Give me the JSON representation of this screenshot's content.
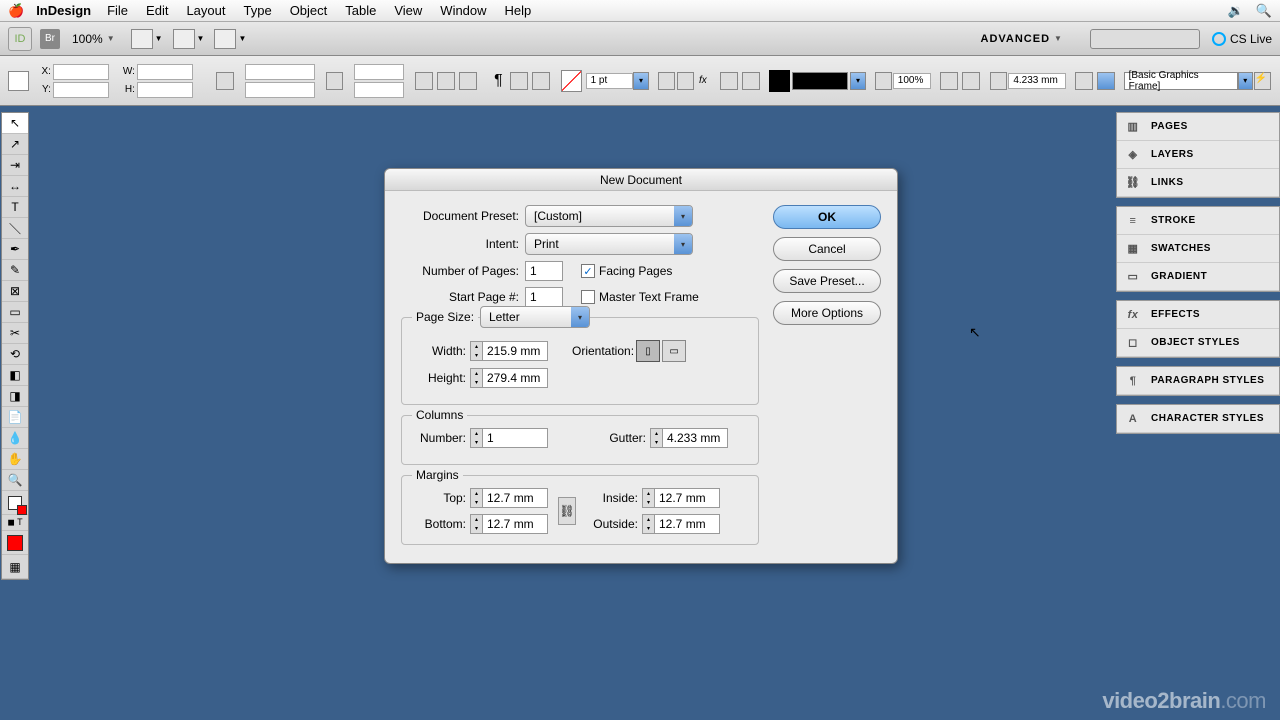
{
  "menubar": {
    "app": "InDesign",
    "items": [
      "File",
      "Edit",
      "Layout",
      "Type",
      "Object",
      "Table",
      "View",
      "Window",
      "Help"
    ]
  },
  "appbar": {
    "zoom": "100%",
    "workspace": "ADVANCED",
    "cs_live": "CS Live"
  },
  "controlbar": {
    "x_label": "X:",
    "y_label": "Y:",
    "w_label": "W:",
    "h_label": "H:",
    "stroke_weight": "1 pt",
    "opacity": "100%",
    "gutter_val": "4.233 mm",
    "preset": "[Basic Graphics Frame]"
  },
  "panels": {
    "group1": [
      "PAGES",
      "LAYERS",
      "LINKS"
    ],
    "group2": [
      "STROKE",
      "SWATCHES",
      "GRADIENT"
    ],
    "group3": [
      "EFFECTS",
      "OBJECT STYLES"
    ],
    "group4": [
      "PARAGRAPH STYLES"
    ],
    "group5": [
      "CHARACTER STYLES"
    ]
  },
  "dialog": {
    "title": "New Document",
    "doc_preset_label": "Document Preset:",
    "doc_preset_value": "[Custom]",
    "intent_label": "Intent:",
    "intent_value": "Print",
    "num_pages_label": "Number of Pages:",
    "num_pages_value": "1",
    "start_page_label": "Start Page #:",
    "start_page_value": "1",
    "facing_pages": "Facing Pages",
    "facing_pages_checked": true,
    "master_text_frame": "Master Text Frame",
    "master_text_frame_checked": false,
    "page_size_legend": "Page Size:",
    "page_size_value": "Letter",
    "width_label": "Width:",
    "width_value": "215.9 mm",
    "height_label": "Height:",
    "height_value": "279.4 mm",
    "orientation_label": "Orientation:",
    "columns_legend": "Columns",
    "columns_number_label": "Number:",
    "columns_number_value": "1",
    "gutter_label": "Gutter:",
    "gutter_value": "4.233 mm",
    "margins_legend": "Margins",
    "margin_top_label": "Top:",
    "margin_top_value": "12.7 mm",
    "margin_bottom_label": "Bottom:",
    "margin_bottom_value": "12.7 mm",
    "margin_inside_label": "Inside:",
    "margin_inside_value": "12.7 mm",
    "margin_outside_label": "Outside:",
    "margin_outside_value": "12.7 mm",
    "ok": "OK",
    "cancel": "Cancel",
    "save_preset": "Save Preset...",
    "more_options": "More Options"
  },
  "watermark": {
    "a": "video2brain",
    "b": ".com"
  }
}
